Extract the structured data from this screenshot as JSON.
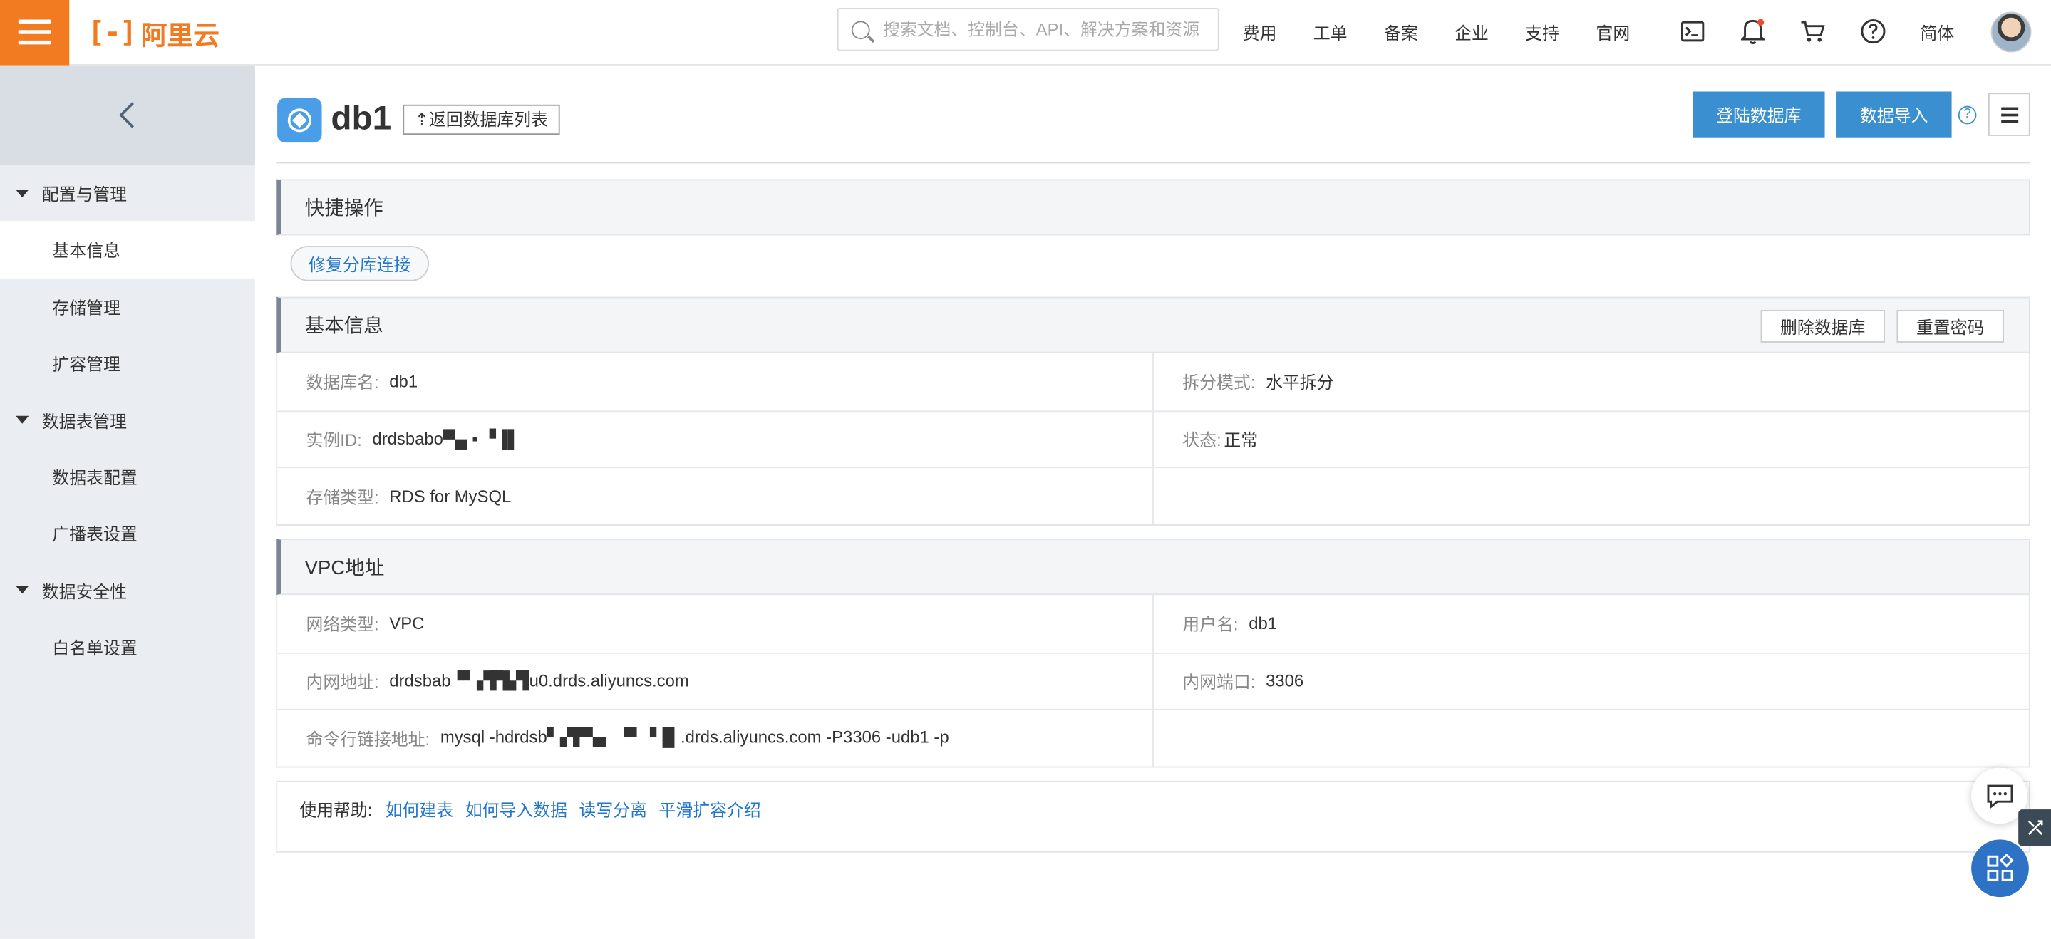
{
  "topbar": {
    "logo_mark": "[-]",
    "logo_text": "阿里云",
    "search_placeholder": "搜索文档、控制台、API、解决方案和资源",
    "nav": [
      "费用",
      "工单",
      "备案",
      "企业",
      "支持",
      "官网"
    ],
    "lang": "简体",
    "icons": [
      "terminal-icon",
      "bell-icon",
      "cart-icon",
      "help-circle-icon"
    ]
  },
  "sidebar": {
    "groups": [
      {
        "label": "配置与管理",
        "items": [
          "基本信息",
          "存储管理",
          "扩容管理"
        ]
      },
      {
        "label": "数据表管理",
        "items": [
          "数据表配置",
          "广播表设置"
        ]
      },
      {
        "label": "数据安全性",
        "items": [
          "白名单设置"
        ]
      }
    ],
    "active_item": "基本信息"
  },
  "header": {
    "title": "db1",
    "back_label": "返回数据库列表",
    "login_db": "登陆数据库",
    "import_data": "数据导入",
    "help": "?"
  },
  "quick": {
    "title": "快捷操作",
    "fix_link": "修复分库连接"
  },
  "basic": {
    "title": "基本信息",
    "delete_btn": "删除数据库",
    "reset_btn": "重置密码",
    "db_name_label": "数据库名:",
    "db_name": "db1",
    "split_label": "拆分模式:",
    "split_value": "水平拆分",
    "instance_label": "实例ID:",
    "instance_value": "drdsbabo▀▄ ▪ ▝▐▌",
    "status_label": "状态:",
    "status_value": "正常",
    "storage_label": "存储类型:",
    "storage_value": "RDS for MySQL"
  },
  "vpc": {
    "title": "VPC地址",
    "net_label": "网络类型:",
    "net_value": "VPC",
    "user_label": "用户名:",
    "user_value": "db1",
    "addr_label": "内网地址:",
    "addr_value": "drdsbab▝▘▞▛▙▜u0.drds.aliyuncs.com",
    "port_label": "内网端口:",
    "port_value": "3306",
    "cmd_label": "命令行链接地址:",
    "cmd_value": "mysql -hdrdsb▘▞▛▚▖ ▝▘▝▐▌.drds.aliyuncs.com -P3306 -udb1 -p"
  },
  "help": {
    "label": "使用帮助:",
    "links": [
      "如何建表",
      "如何导入数据",
      "读写分离",
      "平滑扩容介绍"
    ]
  },
  "colors": {
    "brand": "#f27b22",
    "primary": "#3a8fd0",
    "link": "#2277cc",
    "float_apps": "#2e72c6"
  }
}
